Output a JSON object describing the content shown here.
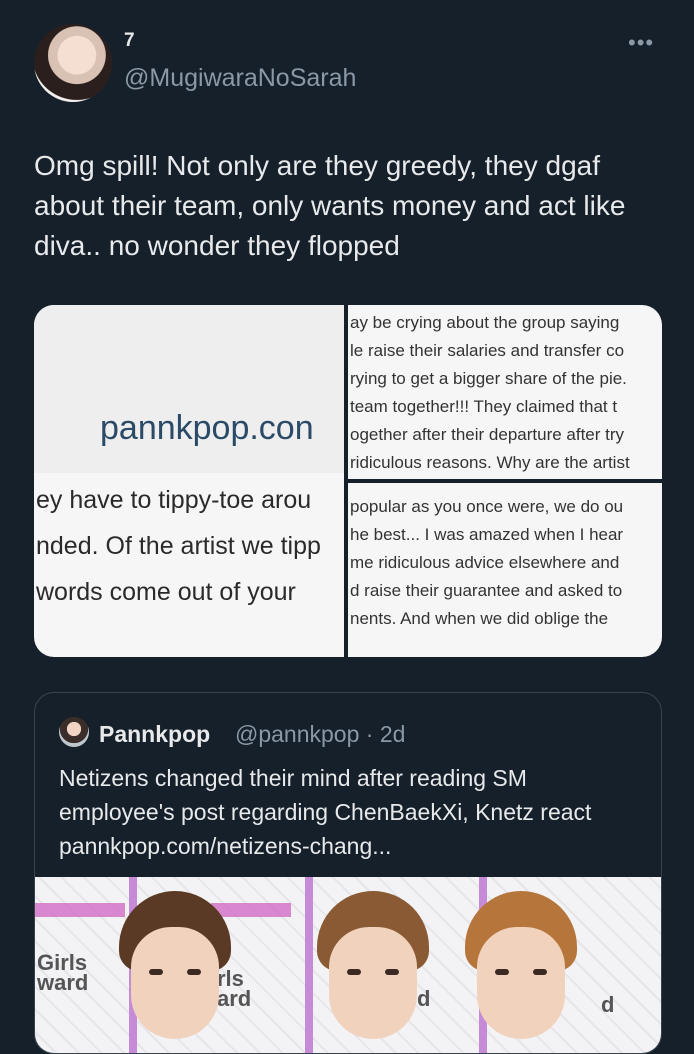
{
  "tweet": {
    "author_name": "7",
    "handle": "@MugiwaraNoSarah",
    "more_icon": "more-horizontal-icon",
    "text": "Omg spill! Not only are they greedy, they dgaf about their team, only wants money and act like diva.. no wonder they flopped"
  },
  "media": {
    "tile1": {
      "logo": "pannkpop.con",
      "lines": [
        "ey have to tippy-toe arou",
        "nded. Of the artist we tipp",
        " words come out of your"
      ]
    },
    "tile2": {
      "lines": [
        "ay be crying about the group saying",
        "le raise their salaries and transfer co",
        "rying to get a bigger share of the pie.",
        " team together!!! They claimed that t",
        "ogether after their departure after try",
        "ridiculous reasons. Why are the artist"
      ]
    },
    "tile3": {
      "lines": [
        "popular as you once were, we do ou",
        "he best... I was amazed when I hear",
        "me ridiculous advice elsewhere and",
        "d raise their guarantee and asked to",
        "nents.  And when we did oblige the"
      ]
    }
  },
  "quote": {
    "author_name": "Pannkpop",
    "handle_time": "@pannkpop · 2d",
    "text": "Netizens changed their mind after reading SM employee's post regarding ChenBaekXi, Knetz react pannkpop.com/netizens-chang...",
    "wall_text_1": "Girls\nward",
    "wall_text_2": "rls\nard",
    "wall_text_3": "d",
    "wall_text_4": "d"
  }
}
